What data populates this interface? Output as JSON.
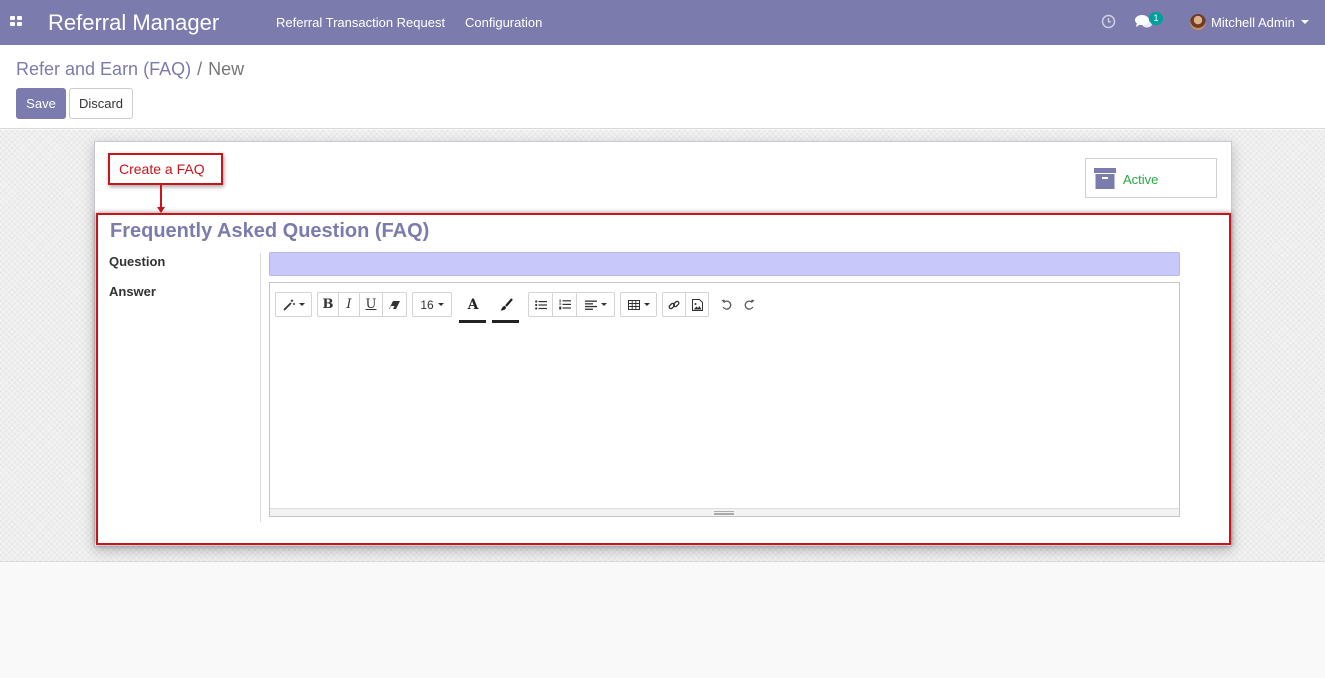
{
  "navbar": {
    "app_title": "Referral Manager",
    "menu": [
      "Referral Transaction Request",
      "Configuration"
    ],
    "chat_count": "1",
    "user_name": "Mitchell Admin",
    "icons": [
      "apps-icon",
      "clock-icon",
      "chat-icon",
      "avatar",
      "caret-down-icon"
    ]
  },
  "breadcrumb": {
    "parent": "Refer and Earn (FAQ)",
    "separator": "/",
    "current": "New"
  },
  "buttons": {
    "save": "Save",
    "discard": "Discard"
  },
  "annotation": {
    "callout": "Create a FAQ"
  },
  "form": {
    "active_label": "Active",
    "title": "Frequently Asked Question (FAQ)",
    "question_label": "Question",
    "question_value": "",
    "answer_label": "Answer"
  },
  "editor_toolbar": {
    "font_size": "16",
    "bold": "B",
    "italic": "I",
    "underline": "U",
    "font_color": "A",
    "buttons": [
      "style-icon",
      "bold",
      "italic",
      "underline",
      "eraser-icon",
      "font-size",
      "font-color-icon",
      "highlight-color-icon",
      "unordered-list-icon",
      "ordered-list-icon",
      "align-icon",
      "table-icon",
      "link-icon",
      "image-icon",
      "undo-icon",
      "redo-icon"
    ]
  },
  "colors": {
    "brand": "#7c7bad",
    "annotation_red": "#c9141b",
    "active_green": "#28a745",
    "required_field": "#c8c8fb"
  }
}
